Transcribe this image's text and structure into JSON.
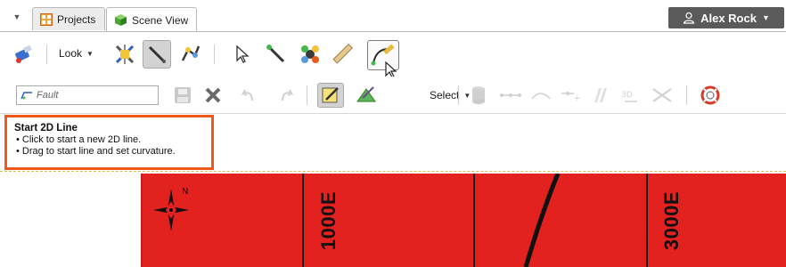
{
  "tabs": {
    "menu_icon": "dropdown-triangle-icon",
    "items": [
      {
        "label": "Projects",
        "icon": "grid-icon",
        "color": "#e0782a"
      },
      {
        "label": "Scene View",
        "icon": "cube-icon",
        "color": "#4aa832"
      }
    ]
  },
  "user": {
    "name": "Alex Rock",
    "icon": "user-icon",
    "bg": "#5a5a5a"
  },
  "toolbar1": {
    "look_label": "Look"
  },
  "toolbar2": {
    "fault_value": "Fault",
    "select_label": "Select"
  },
  "tooltip": {
    "title": "Start 2D Line",
    "lines": [
      "• Click to start a new 2D line.",
      "• Drag to start line and set curvature."
    ],
    "border_color": "#ef5a1a"
  },
  "map": {
    "fill_color": "#e3211f",
    "compass_label": "N",
    "grid_labels": [
      "1000E",
      "3000E"
    ]
  }
}
